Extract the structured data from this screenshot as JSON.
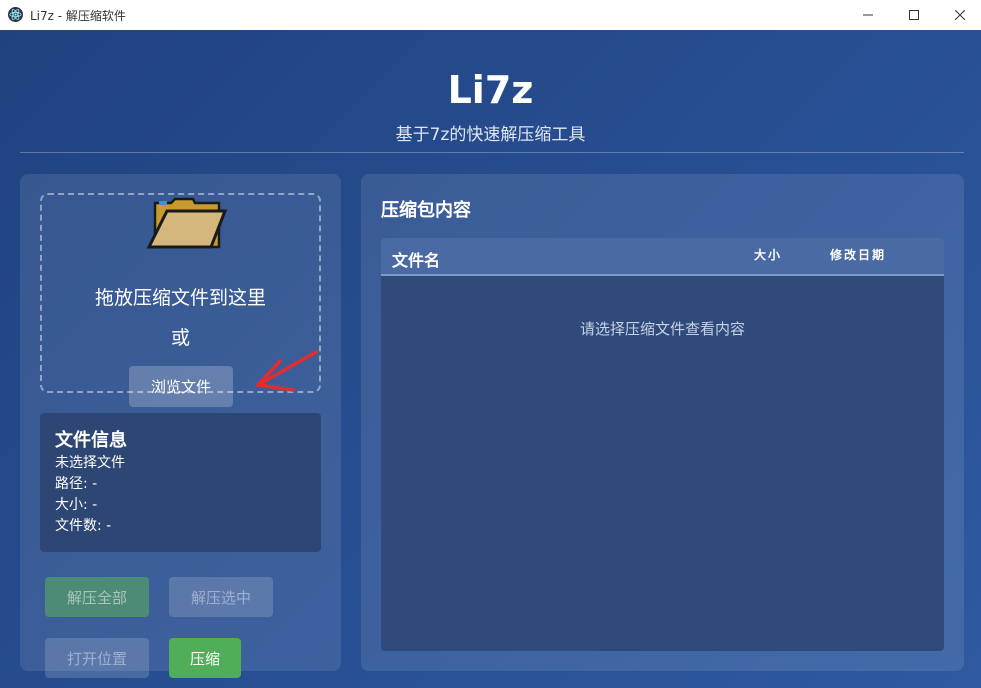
{
  "window": {
    "title": "Li7z - 解压缩软件",
    "icon": "electron-atom-icon"
  },
  "header": {
    "app_name": "Li7z",
    "subtitle": "基于7z的快速解压缩工具"
  },
  "dropzone": {
    "icon": "folder-icon",
    "prompt": "拖放压缩文件到这里",
    "or_text": "或",
    "browse_label": "浏览文件"
  },
  "file_info": {
    "title": "文件信息",
    "status": "未选择文件",
    "path": "路径: -",
    "size": "大小: -",
    "count": "文件数: -"
  },
  "actions": {
    "extract_all": "解压全部",
    "extract_selected": "解压选中",
    "open_location": "打开位置",
    "compress": "压缩"
  },
  "archive": {
    "title": "压缩包内容",
    "columns": {
      "name": "文件名",
      "size": "大小",
      "date": "修改日期"
    },
    "empty_message": "请选择压缩文件查看内容"
  },
  "colors": {
    "background": "#24498a",
    "compress_button": "#4fae57",
    "extract_all_button": "#4e8b76",
    "annotation_arrow": "#e52b2b"
  }
}
